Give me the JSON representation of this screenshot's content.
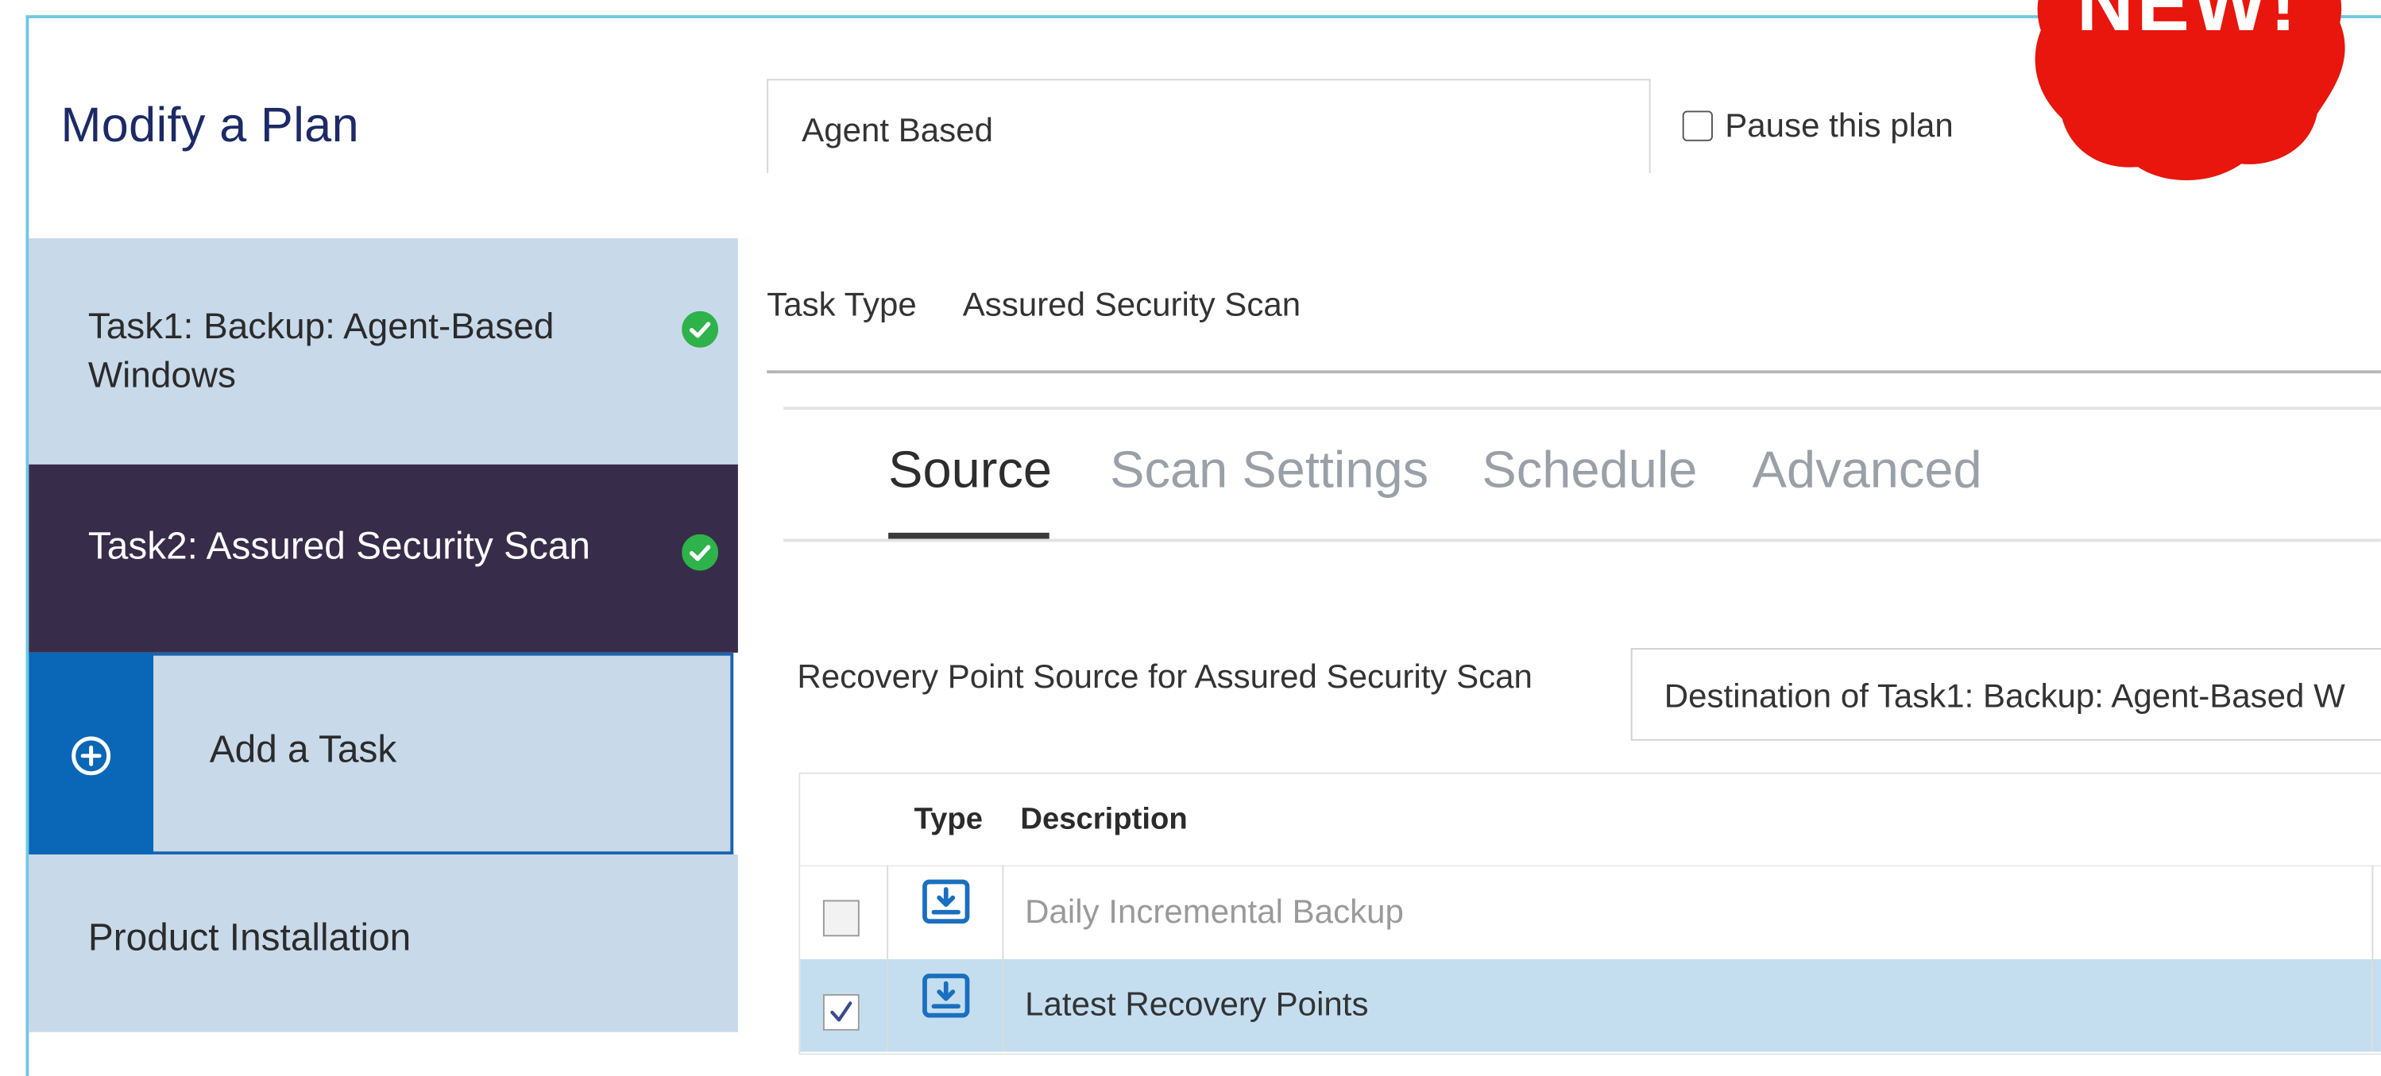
{
  "header": {
    "title": "Modify a Plan",
    "plan_name_value": "Agent Based",
    "pause_label": "Pause this plan",
    "pause_checked": false
  },
  "badge": {
    "text": "NEW!"
  },
  "sidebar": {
    "items": [
      {
        "label": "Task1: Backup: Agent-Based Windows",
        "status": "check-circle-icon"
      },
      {
        "label": "Task2: Assured Security Scan",
        "status": "check-circle-icon",
        "active": true
      },
      {
        "label": "Add a Task",
        "icon": "plus-circle-icon"
      },
      {
        "label": "Product Installation"
      }
    ]
  },
  "task": {
    "type_label": "Task Type",
    "type_value": "Assured Security Scan"
  },
  "tabs": [
    {
      "label": "Source",
      "active": true
    },
    {
      "label": "Scan Settings"
    },
    {
      "label": "Schedule"
    },
    {
      "label": "Advanced"
    }
  ],
  "source": {
    "rps_label": "Recovery Point Source for Assured Security Scan",
    "rps_value": "Destination of Task1: Backup: Agent-Based W"
  },
  "table": {
    "columns": [
      "Type",
      "Description"
    ],
    "rows": [
      {
        "checked": false,
        "icon": "backup-icon",
        "description": "Daily Incremental Backup"
      },
      {
        "checked": true,
        "icon": "backup-icon",
        "description": "Latest Recovery Points"
      }
    ]
  },
  "colors": {
    "frame": "#6ec8e4",
    "sidebar_bg": "#c8d9ea",
    "sidebar_active_bg": "#372c4a",
    "add_task_accent": "#0a66b6",
    "ok_green": "#2eb24a",
    "selected_row": "#c4def0",
    "badge_red": "#e8160c"
  }
}
